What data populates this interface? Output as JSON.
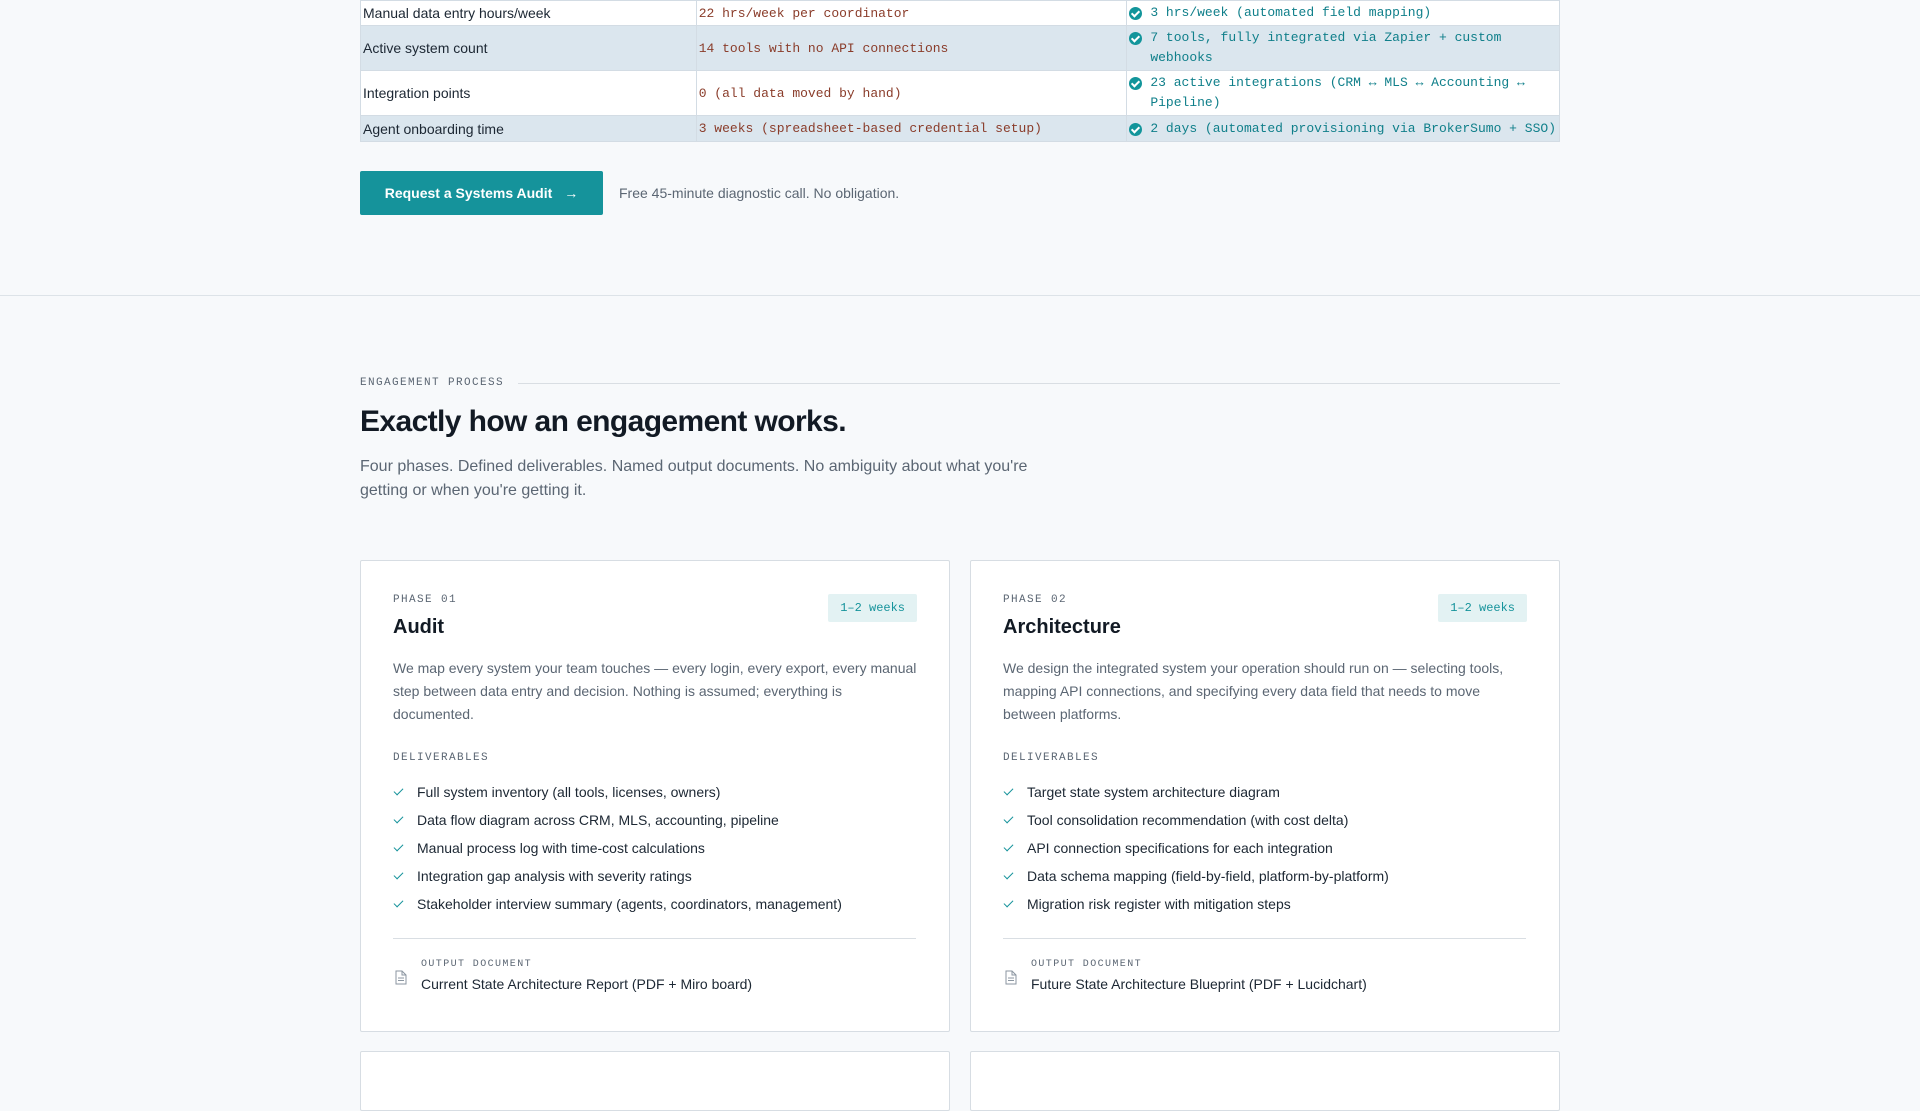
{
  "comparison": {
    "rows": [
      {
        "label": "Manual data entry hours/week",
        "before": "22 hrs/week per coordinator",
        "after": "3 hrs/week (automated field mapping)"
      },
      {
        "label": "Active system count",
        "before": "14 tools with no API connections",
        "after": "7 tools, fully integrated via Zapier + custom webhooks"
      },
      {
        "label": "Integration points",
        "before": "0 (all data moved by hand)",
        "after": "23 active integrations (CRM ↔ MLS ↔ Accounting ↔ Pipeline)"
      },
      {
        "label": "Agent onboarding time",
        "before": "3 weeks (spreadsheet-based credential setup)",
        "after": "2 days (automated provisioning via BrokerSumo + SSO)"
      }
    ]
  },
  "cta": {
    "button_label": "Request a Systems Audit",
    "arrow": "→",
    "note": "Free 45-minute diagnostic call. No obligation."
  },
  "process": {
    "eyebrow": "ENGAGEMENT PROCESS",
    "heading": "Exactly how an engagement works.",
    "lede": "Four phases. Defined deliverables. Named output documents. No ambiguity about what you're getting or when you're getting it."
  },
  "phases": [
    {
      "label": "PHASE 01",
      "duration": "1–2 weeks",
      "title": "Audit",
      "description": "We map every system your team touches — every login, every export, every manual step between data entry and decision. Nothing is assumed; everything is documented.",
      "deliverables_label": "DELIVERABLES",
      "deliverables": [
        "Full system inventory (all tools, licenses, owners)",
        "Data flow diagram across CRM, MLS, accounting, pipeline",
        "Manual process log with time-cost calculations",
        "Integration gap analysis with severity ratings",
        "Stakeholder interview summary (agents, coordinators, management)"
      ],
      "output_label": "OUTPUT DOCUMENT",
      "output_name": "Current State Architecture Report (PDF + Miro board)"
    },
    {
      "label": "PHASE 02",
      "duration": "1–2 weeks",
      "title": "Architecture",
      "description": "We design the integrated system your operation should run on — selecting tools, mapping API connections, and specifying every data field that needs to move between platforms.",
      "deliverables_label": "DELIVERABLES",
      "deliverables": [
        "Target state system architecture diagram",
        "Tool consolidation recommendation (with cost delta)",
        "API connection specifications for each integration",
        "Data schema mapping (field-by-field, platform-by-platform)",
        "Migration risk register with mitigation steps"
      ],
      "output_label": "OUTPUT DOCUMENT",
      "output_name": "Future State Architecture Blueprint (PDF + Lucidchart)"
    }
  ],
  "colors": {
    "accent": "#15939b",
    "before_text": "#8a3c2a",
    "after_text": "#0f7f8a",
    "row_shade": "#dbe6ee"
  }
}
